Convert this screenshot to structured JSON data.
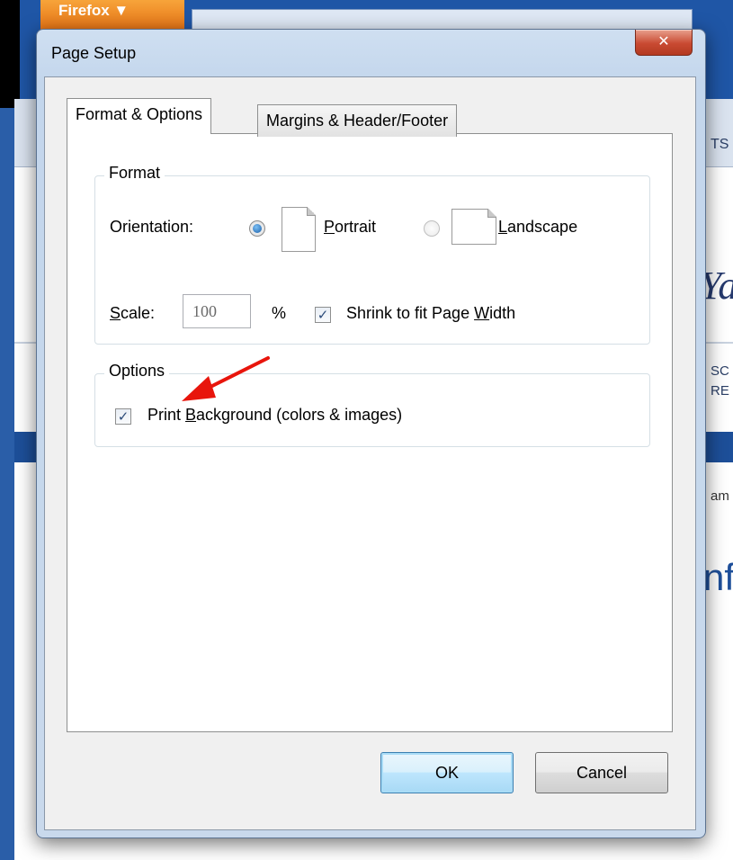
{
  "browser": {
    "app_button": "Firefox ▼",
    "fragments": {
      "ts": "TS",
      "ya": "Ya",
      "sc": "SC\nRE",
      "am": "am",
      "nf": "nf"
    }
  },
  "dialog": {
    "title": "Page Setup",
    "close_glyph": "✕",
    "tabs": [
      {
        "label": "Format & Options",
        "active": true
      },
      {
        "label": "Margins & Header/Footer",
        "active": false
      }
    ],
    "format": {
      "legend": "Format",
      "orientation_label": "Orientation:",
      "portrait": {
        "prefix": "",
        "accel": "P",
        "rest": "ortrait",
        "selected": true
      },
      "landscape": {
        "prefix": "",
        "accel": "L",
        "rest": "andscape",
        "selected": false
      },
      "scale_label_accel": "S",
      "scale_label_rest": "cale:",
      "scale_value": "100",
      "percent": "%",
      "shrink": {
        "prefix": "Shrink to fit Page ",
        "accel": "W",
        "rest": "idth",
        "checked": true
      }
    },
    "options": {
      "legend": "Options",
      "print_bg": {
        "prefix": "Print ",
        "accel": "B",
        "rest": "ackground (colors & images)",
        "checked": true
      }
    },
    "buttons": {
      "ok": "OK",
      "cancel": "Cancel"
    },
    "check_glyph": "✓",
    "annotation_color": "#e8150c"
  }
}
